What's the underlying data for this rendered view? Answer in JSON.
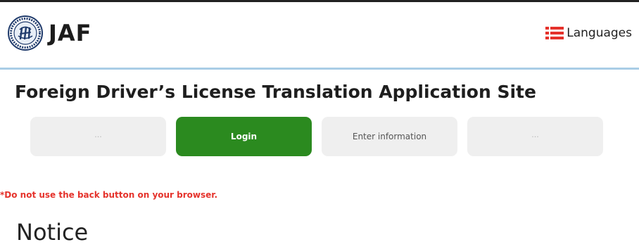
{
  "header": {
    "brand": "JAF",
    "languages_label": "Languages"
  },
  "page": {
    "title": "Foreign Driver’s License Translation Application Site"
  },
  "steps": [
    {
      "label": "···",
      "state": "inactive"
    },
    {
      "label": "Login",
      "state": "active"
    },
    {
      "label": "Enter information",
      "state": "inactive"
    },
    {
      "label": "···",
      "state": "inactive"
    }
  ],
  "warning": "*Do not use the back button on your browser.",
  "notice_heading": "Notice",
  "colors": {
    "active_step": "#2b8a1f",
    "inactive_step": "#efefef",
    "warning": "#e5322b",
    "header_rule": "#a9cde6",
    "lang_icon": "#e5322b"
  },
  "icons": {
    "logo": "jaf-emblem-icon",
    "languages": "list-icon"
  }
}
